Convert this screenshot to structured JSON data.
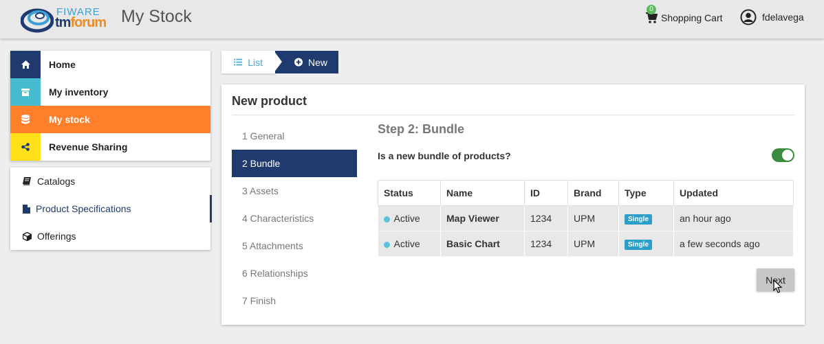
{
  "header": {
    "logo_top": "FIWARE",
    "logo_bottom_a": "tm",
    "logo_bottom_b": "forum",
    "app_title": "My Stock",
    "cart_count": "0",
    "cart_label": "Shopping Cart",
    "username": "fdelavega"
  },
  "menu": {
    "items": [
      {
        "label": "Home",
        "icon": "home-icon"
      },
      {
        "label": "My inventory",
        "icon": "archive-icon"
      },
      {
        "label": "My stock",
        "icon": "database-icon"
      },
      {
        "label": "Revenue Sharing",
        "icon": "share-icon"
      }
    ]
  },
  "submenu": {
    "items": [
      {
        "label": "Catalogs",
        "icon": "book-icon"
      },
      {
        "label": "Product Specifications",
        "icon": "file-icon"
      },
      {
        "label": "Offerings",
        "icon": "cube-icon"
      }
    ]
  },
  "crumbs": {
    "list_label": "List",
    "new_label": "New"
  },
  "panel": {
    "title": "New product",
    "steps": [
      {
        "label": "1 General"
      },
      {
        "label": "2 Bundle"
      },
      {
        "label": "3 Assets"
      },
      {
        "label": "4 Characteristics"
      },
      {
        "label": "5 Attachments"
      },
      {
        "label": "6 Relationships"
      },
      {
        "label": "7 Finish"
      }
    ],
    "active_step": 1,
    "step_title": "Step 2: Bundle",
    "bundle_question": "Is a new bundle of products?",
    "bundle_toggle_on": true,
    "table": {
      "headers": [
        "Status",
        "Name",
        "ID",
        "Brand",
        "Type",
        "Updated"
      ],
      "rows": [
        {
          "status": "Active",
          "name": "Map Viewer",
          "id": "1234",
          "brand": "UPM",
          "type": "Single",
          "updated": "an hour ago"
        },
        {
          "status": "Active",
          "name": "Basic Chart",
          "id": "1234",
          "brand": "UPM",
          "type": "Single",
          "updated": "a few seconds ago"
        }
      ]
    },
    "next_label": "Next"
  },
  "colors": {
    "navy": "#1e3a6e",
    "teal": "#45bcd0",
    "orange": "#ff7f2a",
    "yellow": "#ffe01a",
    "toggle_green": "#3c8a3e",
    "status_dot": "#5bc0de",
    "type_badge": "#2b9fc9"
  }
}
